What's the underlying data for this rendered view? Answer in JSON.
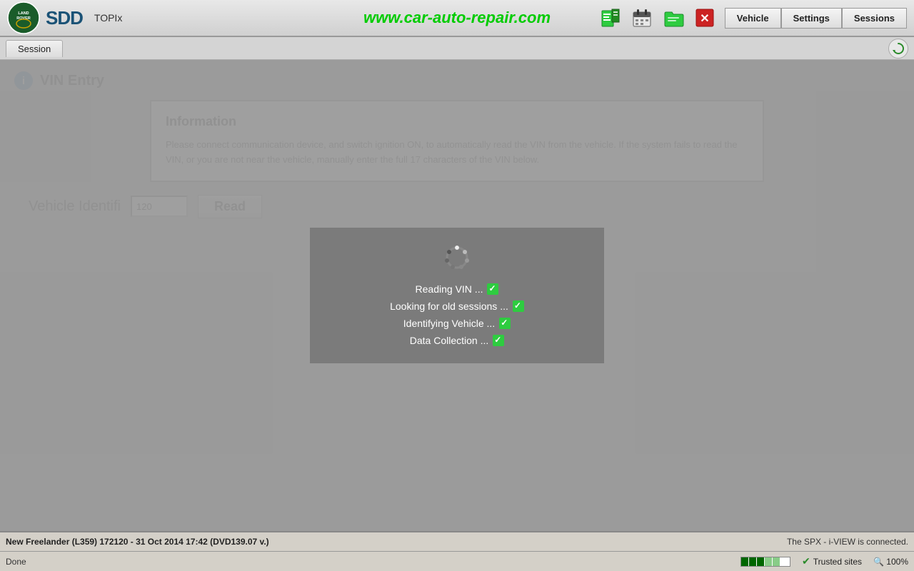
{
  "header": {
    "logo_sdd": "SDD",
    "topix_label": "TOPIx",
    "website_url": "www.car-auto-repair.com",
    "nav_buttons": [
      "Vehicle",
      "Settings",
      "Sessions"
    ]
  },
  "session_bar": {
    "tab_label": "Session",
    "refresh_symbol": "↻"
  },
  "vin_entry": {
    "title": "VIN Entry",
    "info_heading": "Information",
    "info_text": "Please connect communication device, and switch ignition ON, to automatically read the VIN from the vehicle. If the system fails to read the VIN, or you are not near the vehicle, manually enter the full 17 characters of the VIN below.",
    "vehicle_id_label": "Vehicle Identifi",
    "vin_value": "120",
    "read_button": "Read"
  },
  "loading": {
    "status_lines": [
      {
        "text": "Reading VIN ... ",
        "done": true
      },
      {
        "text": "Looking for old sessions ... ",
        "done": true
      },
      {
        "text": "Identifying Vehicle ... ",
        "done": true
      },
      {
        "text": "Data Collection ... ",
        "done": true
      }
    ]
  },
  "status_bar": {
    "vehicle_info": "New Freelander (L359) 172120 - 31 Oct 2014 17:42 (DVD139.07 v.)",
    "connection_info": "The SPX - i-VIEW is connected."
  },
  "browser_bar": {
    "done_label": "Done",
    "trusted_sites_label": "Trusted sites",
    "zoom_label": "100%"
  }
}
